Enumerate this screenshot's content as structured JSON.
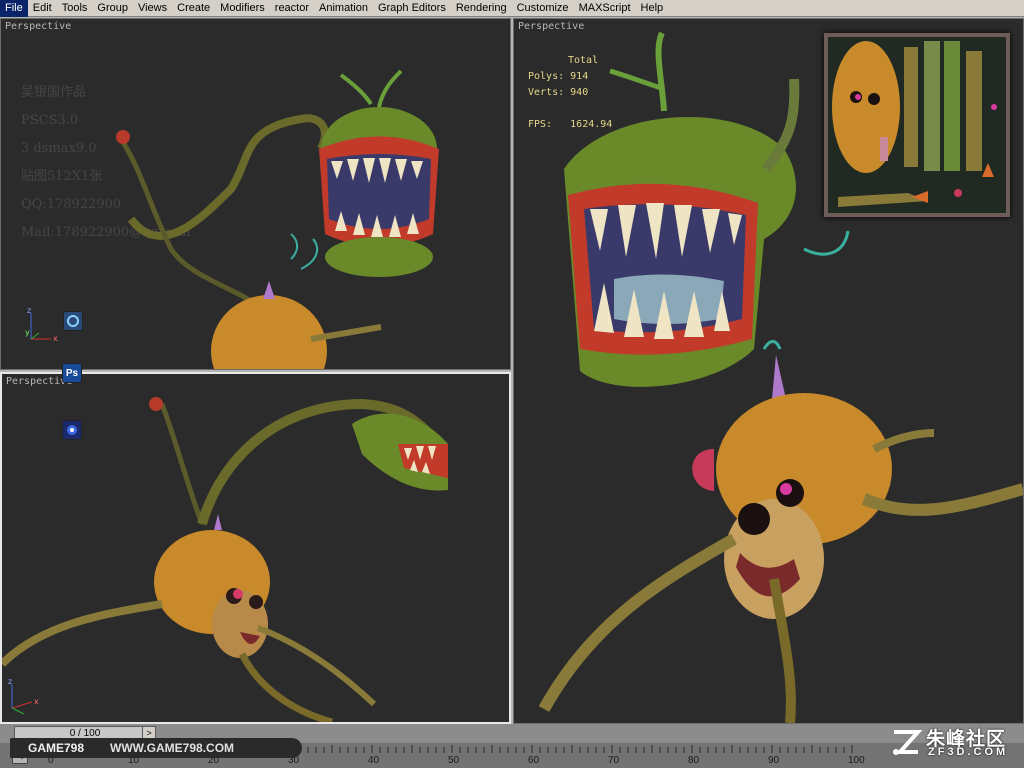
{
  "menu": [
    "File",
    "Edit",
    "Tools",
    "Group",
    "Views",
    "Create",
    "Modifiers",
    "reactor",
    "Animation",
    "Graph Editors",
    "Rendering",
    "Customize",
    "MAXScript",
    "Help"
  ],
  "viewports": {
    "top_left": {
      "label": "Perspective",
      "info_lines": [
        "吴银国作品",
        "PSCS3.0",
        "3 dsmax9.0",
        "贴图512X1张",
        "QQ:178922900",
        "Mail:178922900@qq.com"
      ]
    },
    "bottom_left": {
      "label": "Perspective"
    },
    "right": {
      "label": "Perspective",
      "stats": {
        "total_label": "Total",
        "polys_label": "Polys:",
        "polys": "914",
        "verts_label": "Verts:",
        "verts": "940",
        "fps_label": "FPS:",
        "fps": "1624.94"
      }
    }
  },
  "app_icons": {
    "ps": "Ps"
  },
  "timeline": {
    "slider_text": "0 / 100",
    "prev": "<",
    "next": ">",
    "ticks": [
      "0",
      "10",
      "20",
      "30",
      "40",
      "50",
      "60",
      "70",
      "80",
      "90",
      "100"
    ]
  },
  "watermarks": {
    "left_a": "GAME798",
    "left_b": "WWW.GAME798.COM",
    "right_cn": "朱峰社区",
    "right_en": "ZF3D.COM"
  },
  "colors": {
    "viewport_bg": "#2b2b2b",
    "stats_text": "#e6d88a",
    "plant_green": "#6a8a2a",
    "pumpkin": "#c88a2a",
    "teeth": "#efe4c4",
    "mouth_red": "#c23a2a"
  }
}
